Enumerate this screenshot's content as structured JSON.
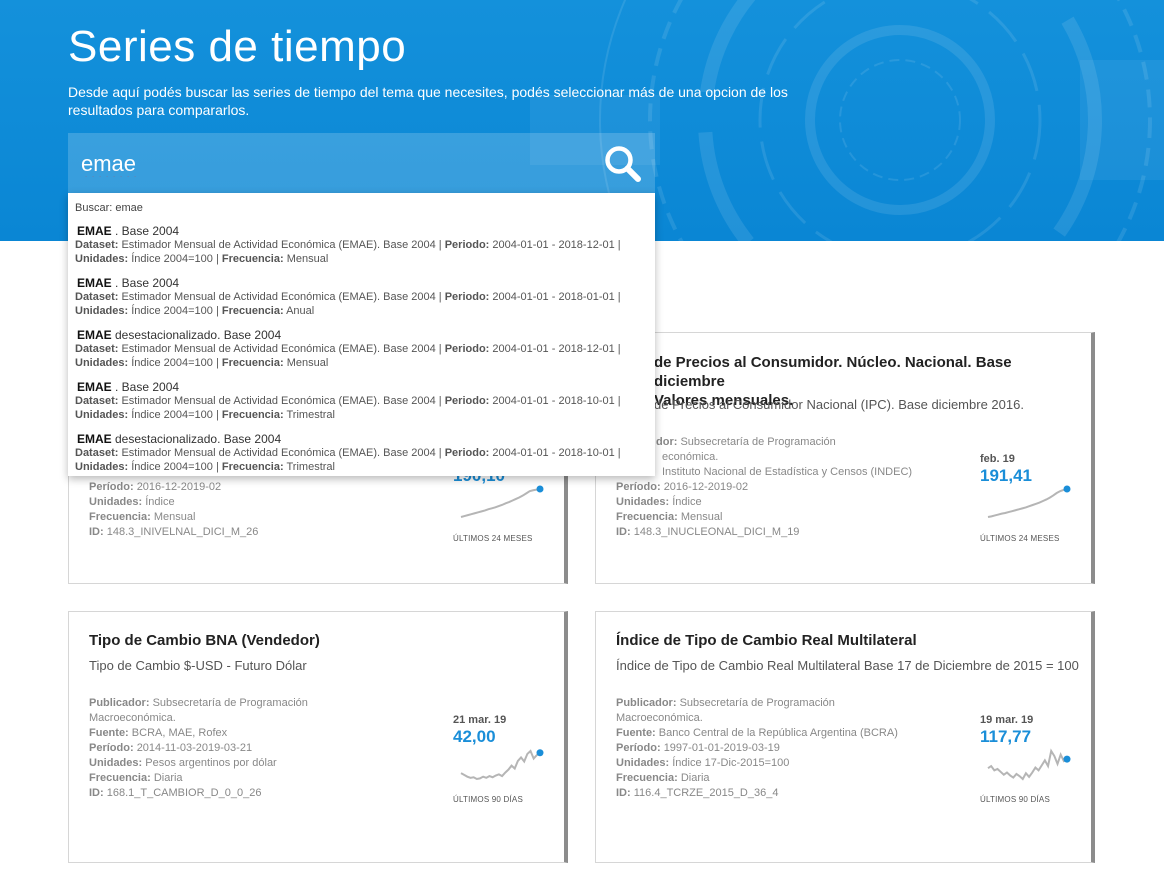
{
  "header": {
    "title": "Series de tiempo",
    "description": "Desde aquí podés buscar las series de tiempo del tema que necesites, podés seleccionar más de una opcion de los resultados para compararlos."
  },
  "search": {
    "value": "emae",
    "placeholder": ""
  },
  "dropdown": {
    "search_line": "Buscar: emae",
    "labels": {
      "dataset": "Dataset:",
      "periodo": "Periodo:",
      "unidades": "Unidades:",
      "frecuencia": "Frecuencia:"
    },
    "items": [
      {
        "name_bold": "EMAE",
        "name_rest": " . Base 2004",
        "dataset": "Estimador Mensual de Actividad Económica (EMAE). Base 2004 |",
        "periodo": "2004-01-01 - 2018-12-01 |",
        "unidades": "Índice 2004=100 |",
        "frecuencia": "Mensual"
      },
      {
        "name_bold": "EMAE",
        "name_rest": " . Base 2004",
        "dataset": "Estimador Mensual de Actividad Económica (EMAE). Base 2004 |",
        "periodo": "2004-01-01 - 2018-01-01 |",
        "unidades": "Índice 2004=100 |",
        "frecuencia": "Anual"
      },
      {
        "name_bold": "EMAE",
        "name_rest": "  desestacionalizado. Base 2004",
        "dataset": "Estimador Mensual de Actividad Económica (EMAE). Base 2004 |",
        "periodo": "2004-01-01 - 2018-12-01 |",
        "unidades": "Índice 2004=100 |",
        "frecuencia": "Mensual"
      },
      {
        "name_bold": "EMAE",
        "name_rest": " . Base 2004",
        "dataset": "Estimador Mensual de Actividad Económica (EMAE). Base 2004 |",
        "periodo": "2004-01-01 - 2018-10-01 |",
        "unidades": "Índice 2004=100 |",
        "frecuencia": "Trimestral"
      },
      {
        "name_bold": "EMAE",
        "name_rest": "  desestacionalizado. Base 2004",
        "dataset": "Estimador Mensual de Actividad Económica (EMAE). Base 2004 |",
        "periodo": "2004-01-01 - 2018-10-01 |",
        "unidades": "Índice 2004=100 |",
        "frecuencia": "Trimestral"
      }
    ]
  },
  "meta_labels": {
    "publicador": "Publicador:",
    "fuente": "Fuente:",
    "periodo": "Período:",
    "unidades": "Unidades:",
    "frecuencia": "Frecuencia:",
    "id": "ID:"
  },
  "cards": [
    {
      "title": "",
      "subtitle": "",
      "publicador": "",
      "publicador_cont": "",
      "fuente": "",
      "periodo": "2016-12-2019-02",
      "unidades": "Índice",
      "frecuencia": "Mensual",
      "id": "148.3_INIVELNAL_DICI_M_26",
      "spark": {
        "date": "",
        "value": "190,10",
        "caption": "ÚLTIMOS 24 MESES",
        "trend": "rising",
        "values": [
          1.0,
          1.03,
          1.06,
          1.09,
          1.12,
          1.15,
          1.18,
          1.21,
          1.25,
          1.28,
          1.31,
          1.35,
          1.39,
          1.44,
          1.48,
          1.53,
          1.58,
          1.63,
          1.69,
          1.76,
          1.83,
          1.86,
          1.88,
          1.9
        ]
      }
    },
    {
      "title": "Índice de Precios al Consumidor. Núcleo. Nacional. Base diciembre 2016. Valores mensuales.",
      "title_visible_part1": "de Precios al Consumidor. Núcleo. Nacional. Base diciembre",
      "title_visible_part2": "Valores mensuales.",
      "subtitle": "de Precios al Consumidor Nacional (IPC). Base diciembre 2016.",
      "publicador": "Subsecretaría de Programación",
      "publicador_cont": "económica.",
      "fuente": "Instituto Nacional de Estadística y Censos (INDEC)",
      "periodo": "2016-12-2019-02",
      "unidades": "Índice",
      "frecuencia": "Mensual",
      "id": "148.3_INUCLEONAL_DICI_M_19",
      "spark": {
        "date": "feb. 19",
        "value": "191,41",
        "caption": "ÚLTIMOS 24 MESES",
        "trend": "rising",
        "values": [
          1.0,
          1.02,
          1.05,
          1.08,
          1.11,
          1.13,
          1.16,
          1.19,
          1.22,
          1.25,
          1.28,
          1.31,
          1.35,
          1.39,
          1.43,
          1.47,
          1.52,
          1.57,
          1.63,
          1.7,
          1.78,
          1.84,
          1.88,
          1.91
        ]
      }
    },
    {
      "title": "Tipo de Cambio BNA (Vendedor)",
      "subtitle": "Tipo de Cambio $-USD - Futuro Dólar",
      "publicador": "Subsecretaría de Programación",
      "publicador_cont": "Macroeconómica.",
      "fuente": "BCRA, MAE, Rofex",
      "periodo": "2014-11-03-2019-03-21",
      "unidades": "Pesos argentinos por dólar",
      "frecuencia": "Diaria",
      "id": "168.1_T_CAMBIOR_D_0_0_26",
      "spark": {
        "date": "21 mar. 19",
        "value": "42,00",
        "caption": "ÚLTIMOS 90 DÍAS",
        "trend": "volatile",
        "values": [
          38.5,
          38.2,
          37.9,
          37.7,
          37.8,
          37.5,
          37.6,
          37.9,
          37.7,
          38.0,
          37.8,
          38.1,
          38.3,
          38.0,
          38.6,
          39.1,
          39.8,
          39.3,
          40.6,
          41.2,
          40.5,
          41.8,
          42.3,
          41.0,
          41.6,
          42.0
        ]
      }
    },
    {
      "title": "Índice de Tipo de Cambio Real Multilateral",
      "subtitle": "Índice de Tipo de Cambio Real Multilateral Base 17 de Diciembre de 2015 = 100",
      "publicador": "Subsecretaría de Programación",
      "publicador_cont": "Macroeconómica.",
      "fuente": "Banco Central de la República Argentina (BCRA)",
      "periodo": "1997-01-01-2019-03-19",
      "unidades": "Índice 17-Dic-2015=100",
      "frecuencia": "Diaria",
      "id": "116.4_TCRZE_2015_D_36_4",
      "spark": {
        "date": "19 mar. 19",
        "value": "117,77",
        "caption": "ÚLTIMOS 90 DÍAS",
        "trend": "volatile",
        "values": [
          116.5,
          116.8,
          116.2,
          116.4,
          116.0,
          115.6,
          115.9,
          115.5,
          115.2,
          115.7,
          115.4,
          115.0,
          115.8,
          115.3,
          115.9,
          116.6,
          116.2,
          116.9,
          117.6,
          116.8,
          118.9,
          118.2,
          117.1,
          118.4,
          117.5,
          117.77
        ]
      }
    }
  ],
  "colors": {
    "hero_blue": "#0a86d4",
    "accent_blue": "#1a8ed8",
    "spark_line": "#b5b5b5",
    "card_shadow": "#8c8c8c"
  }
}
